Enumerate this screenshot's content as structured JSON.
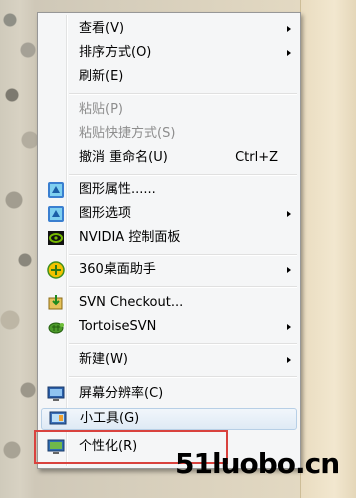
{
  "menu": {
    "items": [
      {
        "label": "查看(V)",
        "submenu": true
      },
      {
        "label": "排序方式(O)",
        "submenu": true
      },
      {
        "label": "刷新(E)"
      },
      {
        "label": "粘贴(P)",
        "disabled": true
      },
      {
        "label": "粘贴快捷方式(S)",
        "disabled": true
      },
      {
        "label": "撤消 重命名(U)",
        "shortcut": "Ctrl+Z"
      },
      {
        "label": "图形属性......",
        "icon": "intel-graphics-icon"
      },
      {
        "label": "图形选项",
        "icon": "intel-graphics-icon",
        "submenu": true
      },
      {
        "label": "NVIDIA 控制面板",
        "icon": "nvidia-icon"
      },
      {
        "label": "360桌面助手",
        "icon": "360-plus-icon",
        "submenu": true
      },
      {
        "label": "SVN Checkout...",
        "icon": "svn-checkout-icon"
      },
      {
        "label": "TortoiseSVN",
        "icon": "tortoisesvn-icon",
        "submenu": true
      },
      {
        "label": "新建(W)",
        "submenu": true
      },
      {
        "label": "屏幕分辨率(C)",
        "icon": "screen-resolution-icon"
      },
      {
        "label": "小工具(G)",
        "icon": "gadgets-icon",
        "hovered": true
      },
      {
        "label": "个性化(R)",
        "icon": "personalize-icon"
      }
    ]
  },
  "watermark": "51luobo.cn",
  "colors": {
    "highlight_border": "#d9423e",
    "hover_border": "#b7cfe6"
  }
}
